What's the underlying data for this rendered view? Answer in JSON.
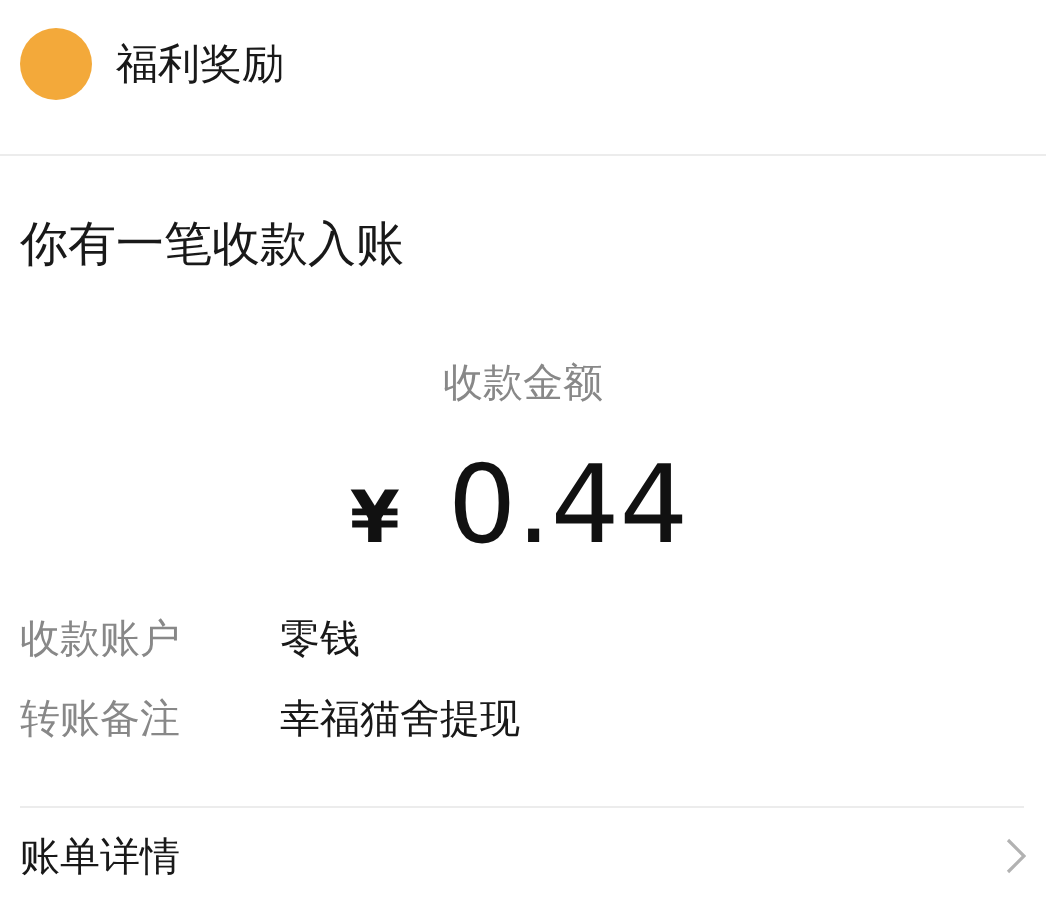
{
  "header": {
    "title": "福利奖励"
  },
  "heading": "你有一笔收款入账",
  "amount": {
    "label": "收款金额",
    "currency": "¥",
    "value": "0.44"
  },
  "details": [
    {
      "label": "收款账户",
      "value": "零钱"
    },
    {
      "label": "转账备注",
      "value": "幸福猫舍提现"
    }
  ],
  "footer_link": {
    "label": "账单详情"
  }
}
